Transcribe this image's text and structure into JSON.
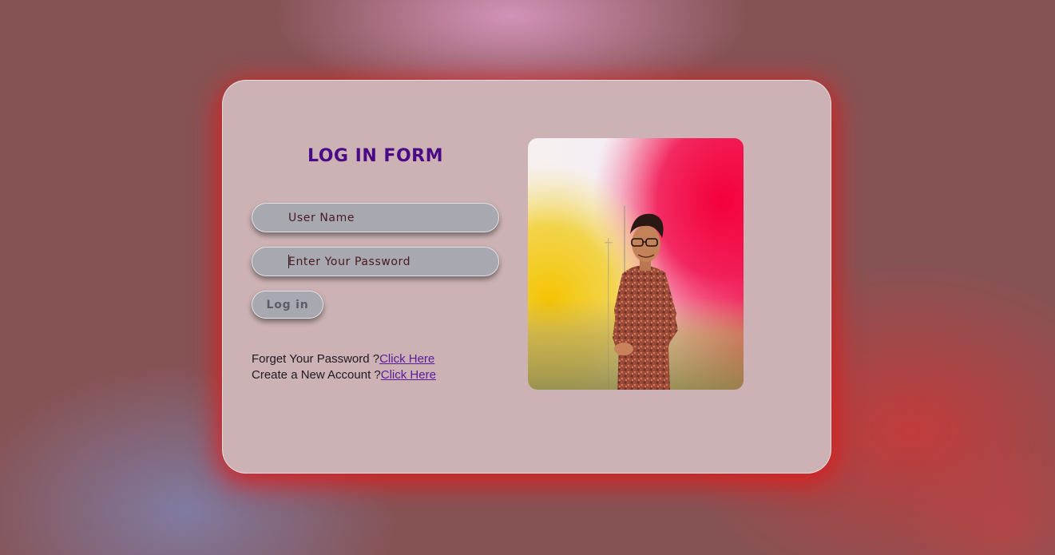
{
  "form": {
    "title": "LOG IN FORM",
    "username_placeholder": "User Name",
    "password_placeholder": "Enter Your Password",
    "login_label": "Log in"
  },
  "links": {
    "forgot_text": "Forget Your Password ?",
    "forgot_link": "Click Here",
    "create_text": "Create a New Account ?",
    "create_link": "Click Here"
  },
  "colors": {
    "title": "#4b0a85",
    "card": "#ccb2b4",
    "card_glow": "#e11919",
    "field": "#a8a8b0",
    "link": "#5a1a9a"
  }
}
